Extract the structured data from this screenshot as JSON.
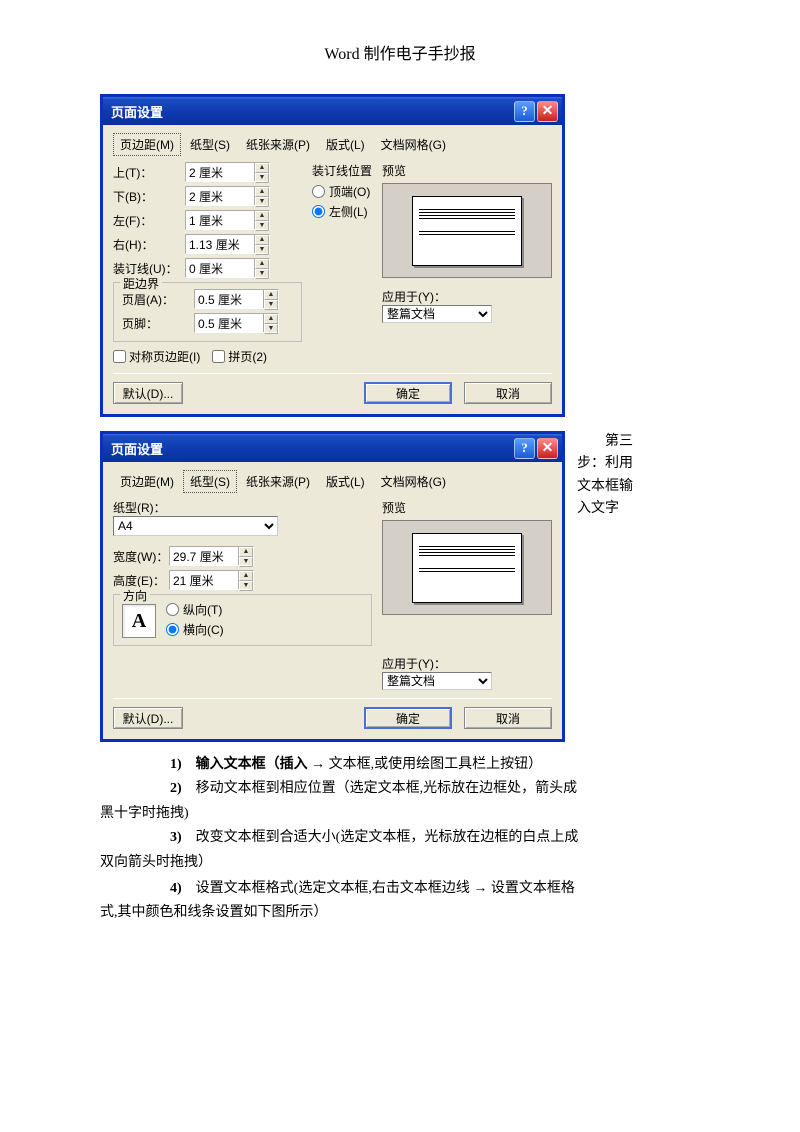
{
  "doc_title": "Word 制作电子手抄报",
  "dialog1": {
    "title": "页面设置",
    "tabs": [
      "页边距(M)",
      "纸型(S)",
      "纸张来源(P)",
      "版式(L)",
      "文档网格(G)"
    ],
    "margins": {
      "top_lbl": "上(T)：",
      "top_v": "2 厘米",
      "bot_lbl": "下(B)：",
      "bot_v": "2 厘米",
      "left_lbl": "左(F)：",
      "left_v": "1 厘米",
      "right_lbl": "右(H)：",
      "right_v": "1.13 厘米",
      "gutter_lbl": "装订线(U)：",
      "gutter_v": "0 厘米"
    },
    "edge_group": "距边界",
    "header_lbl": "页眉(A)：",
    "header_v": "0.5 厘米",
    "footer_lbl": "页脚：",
    "footer_v": "0.5 厘米",
    "gutter_pos_group": "装订线位置",
    "gutter_top": "顶端(O)",
    "gutter_left": "左侧(L)",
    "preview_lbl": "预览",
    "apply_lbl": "应用于(Y)：",
    "apply_v": "整篇文档",
    "mirror_lbl": "对称页边距(I)",
    "twopage_lbl": "拼页(2)",
    "default_btn": "默认(D)...",
    "ok_btn": "确定",
    "cancel_btn": "取消"
  },
  "dialog2": {
    "title": "页面设置",
    "tabs": [
      "页边距(M)",
      "纸型(S)",
      "纸张来源(P)",
      "版式(L)",
      "文档网格(G)"
    ],
    "paper_lbl": "纸型(R)：",
    "paper_v": "A4",
    "width_lbl": "宽度(W)：",
    "width_v": "29.7 厘米",
    "height_lbl": "高度(E)：",
    "height_v": "21 厘米",
    "orient_group": "方向",
    "portrait": "纵向(T)",
    "landscape": "横向(C)",
    "preview_lbl": "预览",
    "apply_lbl": "应用于(Y)：",
    "apply_v": "整篇文档",
    "default_btn": "默认(D)...",
    "ok_btn": "确定",
    "cancel_btn": "取消"
  },
  "sidenote": "　　第三步：利用文本框输入文字",
  "steps": {
    "s1a": "1)　输入文本框（插入 ",
    "s1b": " 文本框,或使用绘图工具栏上按钮）",
    "s2a": "2)　移动文本框到相应位置（选定文本框,光标放在边框处，箭头成",
    "s2b": "黑十字时拖拽)",
    "s3a": "3)　改变文本框到合适大小(选定文本框，光标放在边框的白点上成",
    "s3b": "双向箭头时拖拽）",
    "s4a": "4)　设置文本框格式(选定文本框,右击文本框边线 ",
    "s4b": " 设置文本框格",
    "s4c": "式,其中颜色和线条设置如下图所示）"
  }
}
